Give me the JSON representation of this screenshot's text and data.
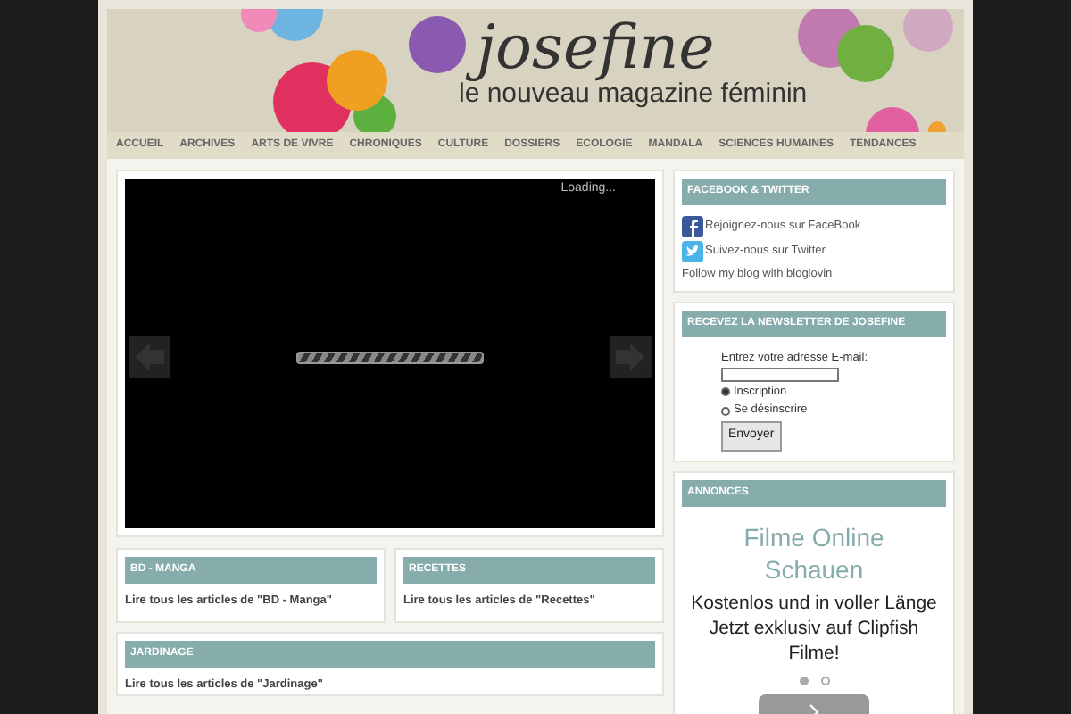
{
  "header": {
    "logo": "josefine",
    "tagline": "le nouveau magazine féminin"
  },
  "nav": [
    {
      "label": "ACCUEIL"
    },
    {
      "label": "ARCHIVES"
    },
    {
      "label": "ARTS DE VIVRE"
    },
    {
      "label": "CHRONIQUES"
    },
    {
      "label": "CULTURE"
    },
    {
      "label": "DOSSIERS"
    },
    {
      "label": "ECOLOGIE"
    },
    {
      "label": "MANDALA"
    },
    {
      "label": "SCIENCES HUMAINES"
    },
    {
      "label": "TENDANCES"
    }
  ],
  "slider": {
    "status": "Loading..."
  },
  "categories": [
    {
      "title": "BD - MANGA",
      "link": "Lire tous les articles de \"BD - Manga\""
    },
    {
      "title": "RECETTES",
      "link": "Lire tous les articles de \"Recettes\""
    },
    {
      "title": "JARDINAGE",
      "link": "Lire tous les articles de \"Jardinage\""
    }
  ],
  "social": {
    "title": "FACEBOOK & TWITTER",
    "links": [
      {
        "kind": "facebook",
        "label": "Rejoignez-nous sur FaceBook"
      },
      {
        "kind": "twitter",
        "label": "Suivez-nous sur Twitter"
      },
      {
        "kind": "text",
        "label": "Follow my blog with bloglovin"
      }
    ]
  },
  "newsletter": {
    "title": "RECEVEZ LA NEWSLETTER DE JOSEFINE",
    "field_label": "Entrez votre adresse E-mail:",
    "options": [
      {
        "label": "Inscription",
        "selected": true
      },
      {
        "label": "Se désinscrire",
        "selected": false
      }
    ],
    "button": "Envoyer"
  },
  "ads": {
    "title": "ANNONCES",
    "headline": "Filme Online Schauen",
    "text": "Kostenlos und in voller Länge Jetzt exklusiv auf Clipfish Filme!",
    "dots": [
      {
        "selected": true
      },
      {
        "selected": false
      }
    ]
  }
}
